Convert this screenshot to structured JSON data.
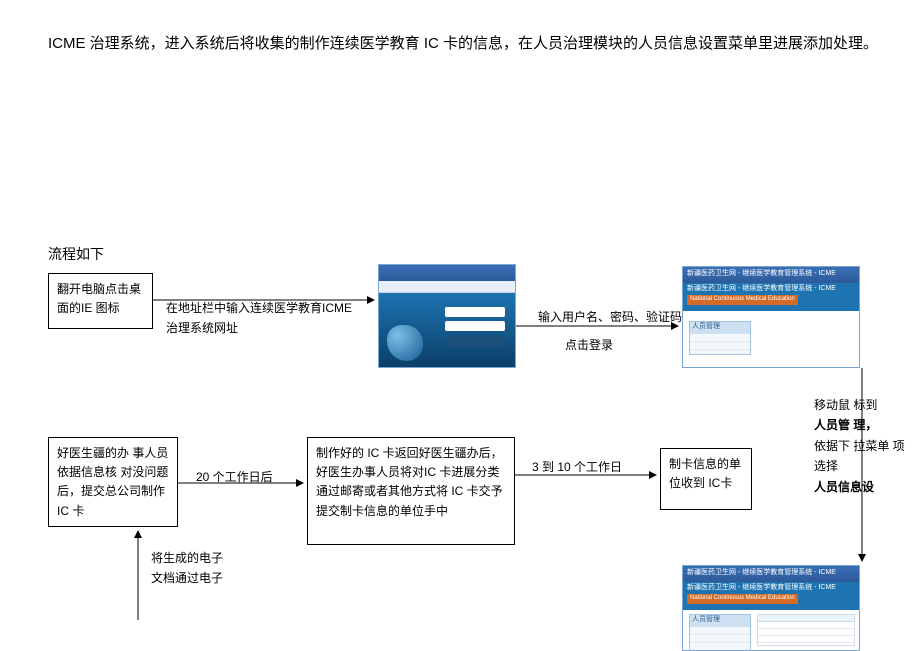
{
  "intro": "ICME 治理系统，进入系统后将收集的制作连续医学教育 IC 卡的信息，在人员治理模块的人员信息设置菜单里进展添加处理。",
  "flow_label": "流程如下",
  "nodes": {
    "n1": "翻开电脑点击桌面的IE 图标",
    "n4_title": "人员管理",
    "n5": "好医生疆的办  事人员依据信息核  对没问题后，提交总公司制作IC 卡",
    "n6": "制作好的  IC  卡返回好医生疆办后，好医生办事人员将对IC 卡进展分类通过邮寄或者其他方式将  IC  卡交予提交制卡信息的单位手中",
    "n7": "制卡信息的单位收到 IC卡"
  },
  "edges": {
    "e1": "在地址栏中输入连续医学教育ICME 治理系统网址",
    "e2a": "输入用户名、密码、验证码",
    "e2b": "点击登录",
    "e3a": "移动鼠  标到",
    "e3b": "人员管  理，",
    "e3c": "依据下  拉菜单  项选择",
    "e3d": "人员信息设",
    "e4": "将生成的电子文档通过电子",
    "e5": "20 个工作日后",
    "e6": "3 到 10 个工作日"
  },
  "thumbs": {
    "systemTitle": "新疆医药卫生网 - 继续医学教育管理系统 - ICME",
    "systemSub": "National Continuous Medical Education"
  }
}
